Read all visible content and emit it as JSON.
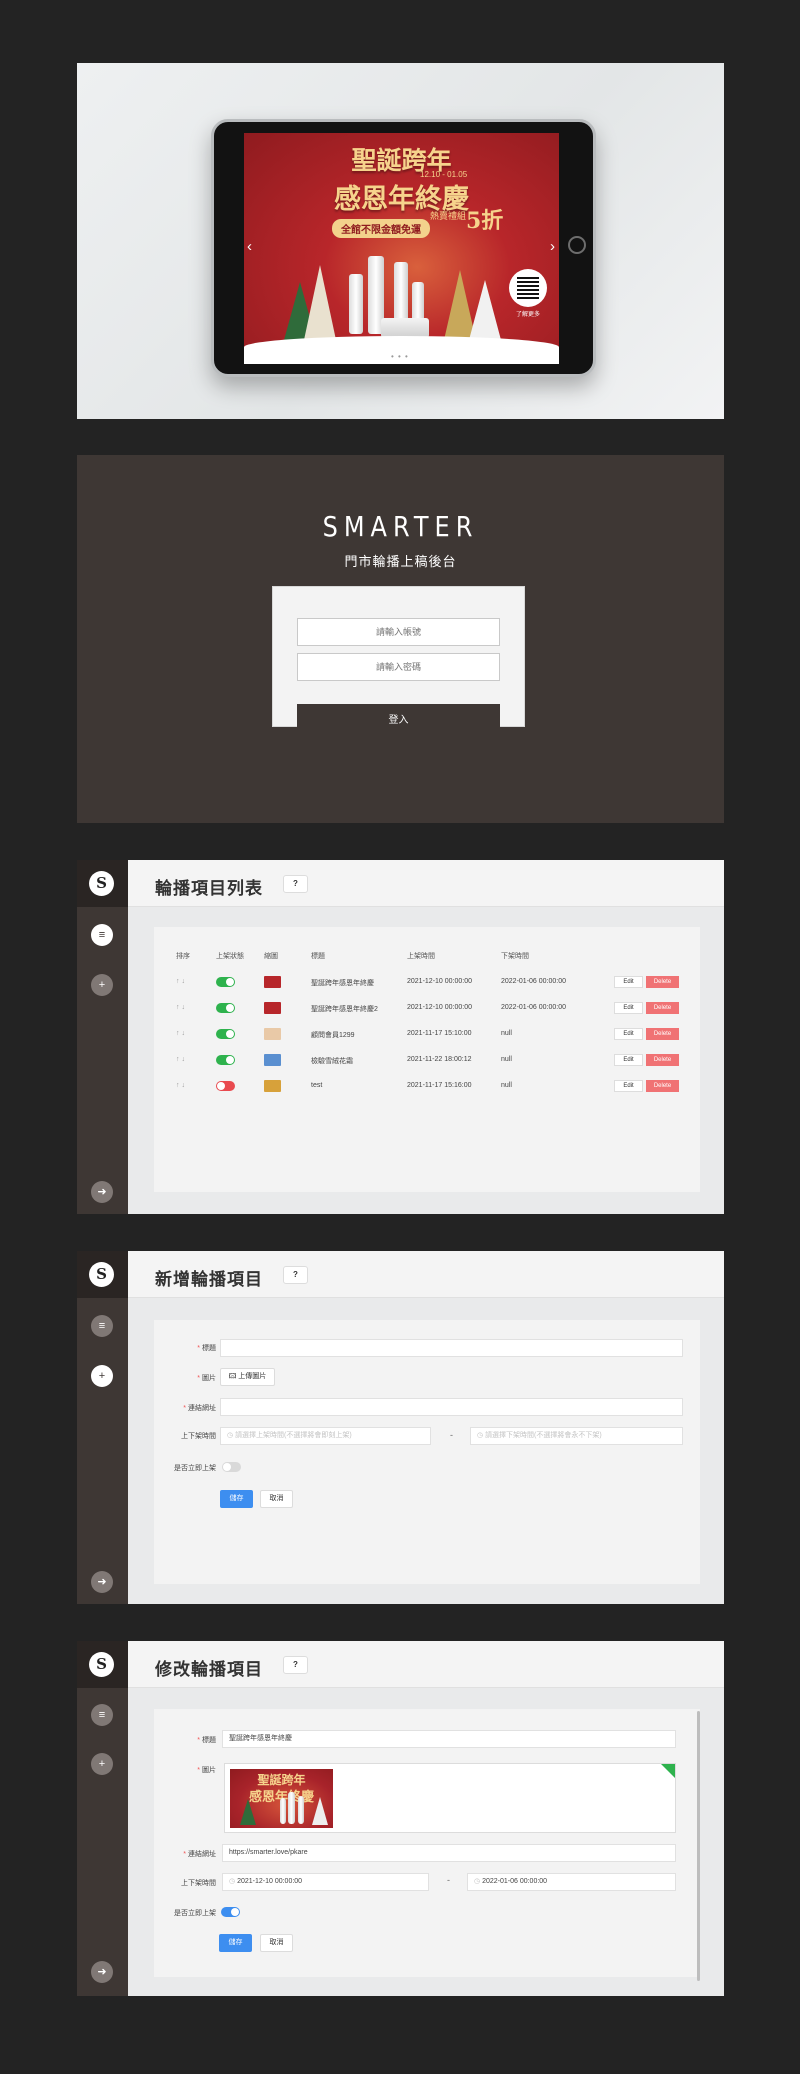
{
  "banner": {
    "title_line1": "聖誕跨年",
    "title_line2": "感恩年終慶",
    "date": "12.10 - 01.05",
    "tag": "全館不限金額免運",
    "gift": "熱賣禮組",
    "five": "5折",
    "qr_label": "了解更多",
    "prev_arrow": "‹",
    "next_arrow": "›",
    "dots": "• • •"
  },
  "login": {
    "brand": "SMARTER",
    "subtitle": "門市輪播上稿後台",
    "account_placeholder": "請輸入帳號",
    "password_placeholder": "請輸入密碼",
    "login_label": "登入"
  },
  "sidebar": {
    "logo": "S",
    "list_icon": "≡",
    "add_icon": "+",
    "logout_icon": "➜"
  },
  "help_label": "?",
  "list_page": {
    "title": "輪播項目列表",
    "columns": [
      "排序",
      "上架狀態",
      "縮圖",
      "標題",
      "上架時間",
      "下架時間"
    ],
    "sort_label": "↑ ↓",
    "edit_label": "Edit",
    "delete_label": "Delete",
    "rows": [
      {
        "title": "聖誕跨年感恩年終慶",
        "start": "2021-12-10 00:00:00",
        "end": "2022-01-06 00:00:00",
        "on": true,
        "thumb": "#b7262a"
      },
      {
        "title": "聖誕跨年感恩年終慶2",
        "start": "2021-12-10 00:00:00",
        "end": "2022-01-06 00:00:00",
        "on": true,
        "thumb": "#b7262a"
      },
      {
        "title": "顧問會員1299",
        "start": "2021-11-17 15:10:00",
        "end": "null",
        "on": true,
        "thumb": "#e9c9a7"
      },
      {
        "title": "檢驗雪絨花霜",
        "start": "2021-11-22 18:00:12",
        "end": "null",
        "on": true,
        "thumb": "#5a8fd0"
      },
      {
        "title": "test",
        "start": "2021-11-17 15:16:00",
        "end": "null",
        "on": false,
        "thumb": "#d7a13a"
      }
    ]
  },
  "add_page": {
    "title": "新增輪播項目",
    "label_title": "標題",
    "label_image": "圖片",
    "upload_label": "上傳圖片",
    "label_link": "連結網址",
    "label_time": "上下架時間",
    "start_placeholder": "請選擇上架時間(不選擇將會即刻上架)",
    "end_placeholder": "請選擇下架時間(不選擇將會永不下架)",
    "dash": "-",
    "label_publish": "是否立即上架",
    "save_label": "儲存",
    "cancel_label": "取消"
  },
  "edit_page": {
    "title": "修改輪播項目",
    "label_title": "標題",
    "title_value": "聖誕跨年感恩年終慶",
    "label_image": "圖片",
    "label_link": "連結網址",
    "link_value": "https://smarter.love/pkare",
    "label_time": "上下架時間",
    "start_value": "2021-12-10 00:00:00",
    "end_value": "2022-01-06 00:00:00",
    "dash": "-",
    "label_publish": "是否立即上架",
    "save_label": "儲存",
    "cancel_label": "取消"
  },
  "colors": {
    "dark": "#3e3734",
    "accent_blue": "#3d8ef0",
    "on_green": "#2eb24d",
    "off_red": "#e94a4f",
    "delete_red": "#f07274"
  }
}
